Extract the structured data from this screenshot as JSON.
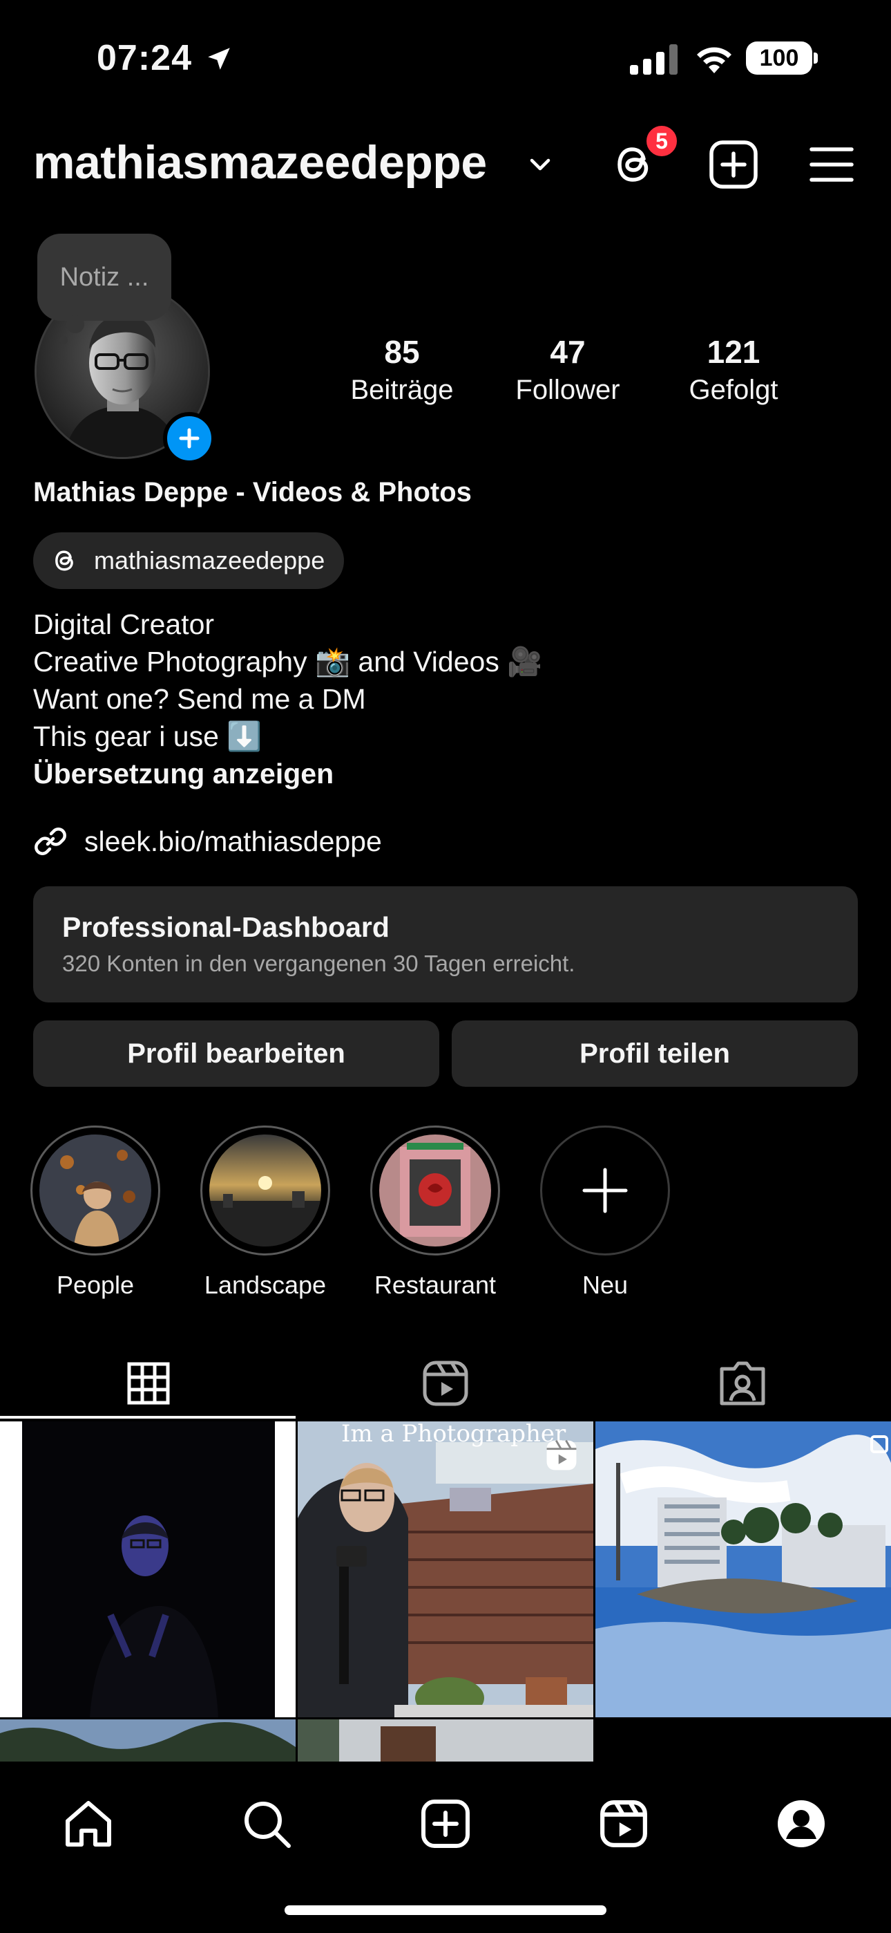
{
  "status_bar": {
    "time": "07:24",
    "battery": "100"
  },
  "header": {
    "username": "mathiasmazeedeppe",
    "threads_badge": "5"
  },
  "note": {
    "text": "Notiz ..."
  },
  "stats": [
    {
      "value": "85",
      "label": "Beiträge"
    },
    {
      "value": "47",
      "label": "Follower"
    },
    {
      "value": "121",
      "label": "Gefolgt"
    }
  ],
  "profile": {
    "full_name": "Mathias Deppe - Videos & Photos",
    "threads_handle": "mathiasmazeedeppe",
    "bio": [
      "Digital Creator",
      "Creative Photography 📸 and Videos 🎥",
      "Want one? Send me a DM",
      "This gear i use ⬇️"
    ],
    "translate": "Übersetzung anzeigen",
    "link": "sleek.bio/mathiasdeppe"
  },
  "dashboard": {
    "title": "Professional-Dashboard",
    "subtitle": "320 Konten in den vergangenen 30 Tagen erreicht."
  },
  "buttons": {
    "edit": "Profil bearbeiten",
    "share": "Profil teilen"
  },
  "highlights": [
    {
      "label": "People"
    },
    {
      "label": "Landscape"
    },
    {
      "label": "Restaurant"
    },
    {
      "label": "Neu"
    }
  ],
  "grid": {
    "caption": "Im a Photographer"
  },
  "colors": {
    "background": "#000000",
    "surface": "#262626",
    "accent": "#0095f6",
    "badge": "#ff3040"
  }
}
